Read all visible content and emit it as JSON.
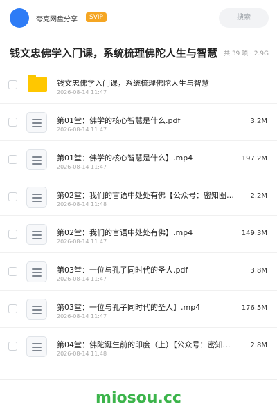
{
  "header": {
    "brand": "夸克网盘分享",
    "badge": "SVIP",
    "search_label": "搜索"
  },
  "share": {
    "title": "钱文忠佛学入门课，系统梳理佛陀人生与智慧",
    "meta": "共 39 项 · 2.9G"
  },
  "files": [
    {
      "icon": "folder-icon",
      "name": "钱文忠佛学入门课，系统梳理佛陀人生与智慧",
      "date": "2026-08-14 11:47",
      "size": ""
    },
    {
      "icon": "document-icon",
      "name": "第01堂：佛学的核心智慧是什么.pdf",
      "date": "2026-08-14 11:47",
      "size": "3.2M"
    },
    {
      "icon": "document-icon",
      "name": "第01堂：佛学的核心智慧是什么】.mp4",
      "date": "2026-08-14 11:47",
      "size": "197.2M"
    },
    {
      "icon": "document-icon",
      "name": "第02堂：我们的言语中处处有佛【公众号：密知圈】.…",
      "date": "2026-08-14 11:48",
      "size": "2.2M"
    },
    {
      "icon": "document-icon",
      "name": "第02堂：我们的言语中处处有佛】.mp4",
      "date": "2026-08-14 11:47",
      "size": "149.3M"
    },
    {
      "icon": "document-icon",
      "name": "第03堂：一位与孔子同时代的圣人.pdf",
      "date": "2026-08-14 11:47",
      "size": "3.8M"
    },
    {
      "icon": "document-icon",
      "name": "第03堂：一位与孔子同时代的圣人】.mp4",
      "date": "2026-08-14 11:47",
      "size": "176.5M"
    },
    {
      "icon": "document-icon",
      "name": "第04堂：佛陀诞生前的印度（上）【公众号：密知圈】…",
      "date": "2026-08-14 11:48",
      "size": "2.8M"
    }
  ],
  "watermark": "miosou.cc"
}
